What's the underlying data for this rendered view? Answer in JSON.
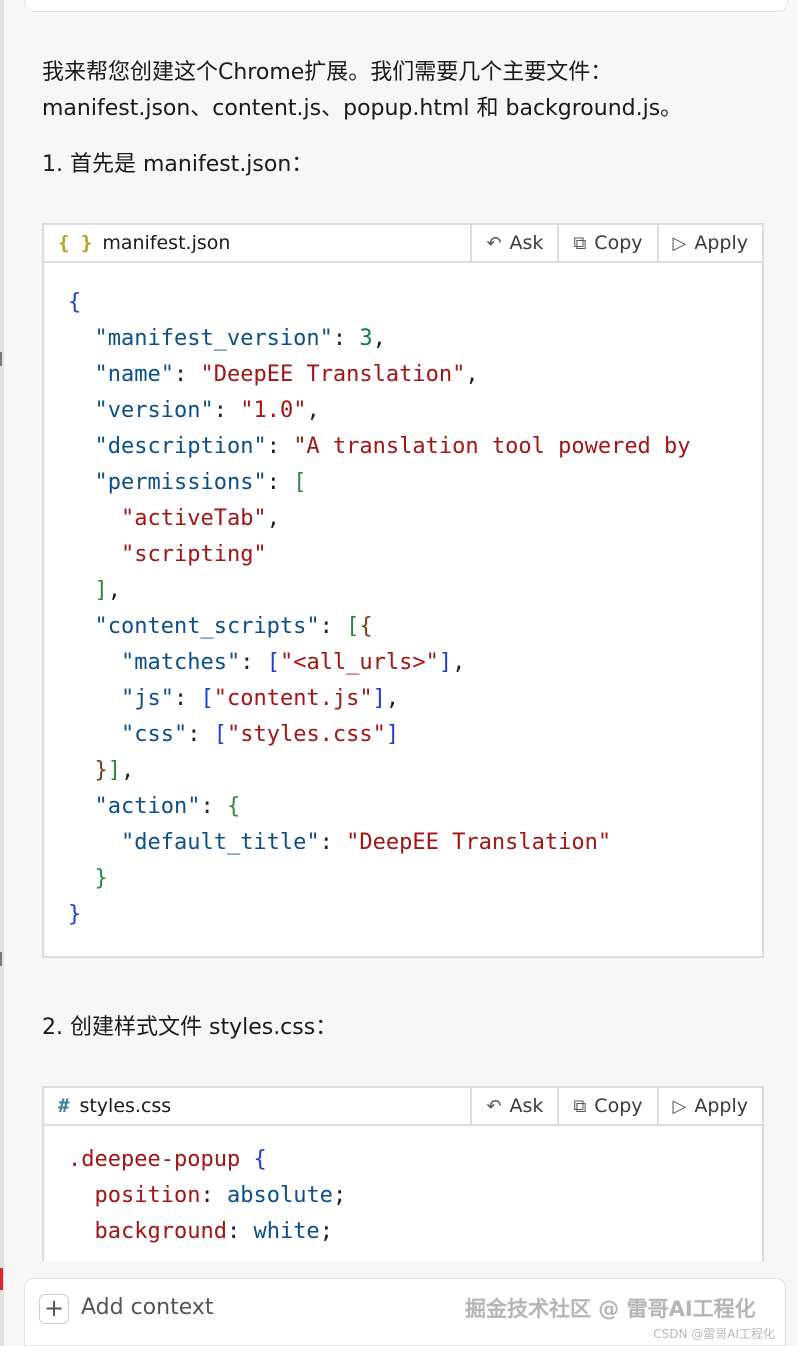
{
  "intro": {
    "line1": "我来帮您创建这个Chrome扩展。我们需要几个主要文件：",
    "line2": "manifest.json、content.js、popup.html 和 background.js。",
    "step1": "1. 首先是 manifest.json：",
    "step2": "2. 创建样式文件 styles.css："
  },
  "actions": {
    "ask": "Ask",
    "copy": "Copy",
    "apply": "Apply"
  },
  "icons": {
    "ask": "undo-arrow-icon",
    "copy": "copy-icon",
    "apply": "play-triangle-icon",
    "json": "braces-icon",
    "css": "hash-icon",
    "add": "plus-icon"
  },
  "manifest_block": {
    "icon": "{ }",
    "filename": "manifest.json",
    "lines": [
      [
        [
          "b1",
          "{"
        ]
      ],
      [
        [
          "p",
          "  "
        ],
        [
          "k",
          "\"manifest_version\""
        ],
        [
          "p",
          ": "
        ],
        [
          "n",
          "3"
        ],
        [
          "p",
          ","
        ]
      ],
      [
        [
          "p",
          "  "
        ],
        [
          "k",
          "\"name\""
        ],
        [
          "p",
          ": "
        ],
        [
          "s",
          "\"DeepEE Translation\""
        ],
        [
          "p",
          ","
        ]
      ],
      [
        [
          "p",
          "  "
        ],
        [
          "k",
          "\"version\""
        ],
        [
          "p",
          ": "
        ],
        [
          "s",
          "\"1.0\""
        ],
        [
          "p",
          ","
        ]
      ],
      [
        [
          "p",
          "  "
        ],
        [
          "k",
          "\"description\""
        ],
        [
          "p",
          ": "
        ],
        [
          "s",
          "\"A translation tool powered by"
        ]
      ],
      [
        [
          "p",
          "  "
        ],
        [
          "k",
          "\"permissions\""
        ],
        [
          "p",
          ": "
        ],
        [
          "b2",
          "["
        ]
      ],
      [
        [
          "p",
          "    "
        ],
        [
          "s",
          "\"activeTab\""
        ],
        [
          "p",
          ","
        ]
      ],
      [
        [
          "p",
          "    "
        ],
        [
          "s",
          "\"scripting\""
        ]
      ],
      [
        [
          "p",
          "  "
        ],
        [
          "b2",
          "]"
        ],
        [
          "p",
          ","
        ]
      ],
      [
        [
          "p",
          "  "
        ],
        [
          "k",
          "\"content_scripts\""
        ],
        [
          "p",
          ": "
        ],
        [
          "b2",
          "["
        ],
        [
          "b3",
          "{"
        ]
      ],
      [
        [
          "p",
          "    "
        ],
        [
          "k",
          "\"matches\""
        ],
        [
          "p",
          ": "
        ],
        [
          "b1",
          "["
        ],
        [
          "s",
          "\"<all_urls>\""
        ],
        [
          "b1",
          "]"
        ],
        [
          "p",
          ","
        ]
      ],
      [
        [
          "p",
          "    "
        ],
        [
          "k",
          "\"js\""
        ],
        [
          "p",
          ": "
        ],
        [
          "b1",
          "["
        ],
        [
          "s",
          "\"content.js\""
        ],
        [
          "b1",
          "]"
        ],
        [
          "p",
          ","
        ]
      ],
      [
        [
          "p",
          "    "
        ],
        [
          "k",
          "\"css\""
        ],
        [
          "p",
          ": "
        ],
        [
          "b1",
          "["
        ],
        [
          "s",
          "\"styles.css\""
        ],
        [
          "b1",
          "]"
        ]
      ],
      [
        [
          "p",
          "  "
        ],
        [
          "b3",
          "}"
        ],
        [
          "b2",
          "]"
        ],
        [
          "p",
          ","
        ]
      ],
      [
        [
          "p",
          "  "
        ],
        [
          "k",
          "\"action\""
        ],
        [
          "p",
          ": "
        ],
        [
          "b2",
          "{"
        ]
      ],
      [
        [
          "p",
          "    "
        ],
        [
          "k",
          "\"default_title\""
        ],
        [
          "p",
          ": "
        ],
        [
          "s",
          "\"DeepEE Translation\""
        ]
      ],
      [
        [
          "p",
          "  "
        ],
        [
          "b2",
          "}"
        ]
      ],
      [
        [
          "b1",
          "}"
        ]
      ]
    ]
  },
  "css_block": {
    "icon": "#",
    "filename": "styles.css",
    "lines": [
      [
        [
          "s",
          ".deepee-popup"
        ],
        [
          "p",
          " "
        ],
        [
          "b1",
          "{"
        ]
      ],
      [
        [
          "p",
          "  "
        ],
        [
          "s",
          "position"
        ],
        [
          "p",
          ": "
        ],
        [
          "k",
          "absolute"
        ],
        [
          "p",
          ";"
        ]
      ],
      [
        [
          "p",
          "  "
        ],
        [
          "s",
          "background"
        ],
        [
          "p",
          ": "
        ],
        [
          "k",
          "white"
        ],
        [
          "p",
          ";"
        ]
      ]
    ]
  },
  "bottom": {
    "plus": "+",
    "add_context": "Add context",
    "watermark": "掘金技术社区 @ 雷哥AI工程化",
    "watermark_small": "CSDN @雷哥AI工程化"
  },
  "colors": {
    "key": "#0b4f8a",
    "string": "#a31515",
    "number": "#0b7a5c",
    "brace_blue": "#1b3fcf",
    "bracket_green": "#2b8a3e",
    "brace_brown": "#7a3e10",
    "json_icon": "#b8a21a",
    "css_icon": "#3c7f9c"
  }
}
